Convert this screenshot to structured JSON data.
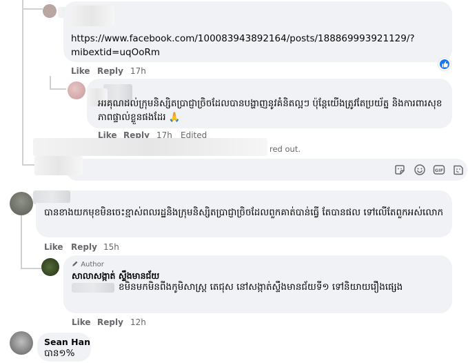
{
  "thread": {
    "link_comment": {
      "text": "https://www.facebook.com/100083943892164/posts/188869993921129/?mibextid=uqOoRm",
      "like": "Like",
      "reply": "Reply",
      "time": "17h",
      "reaction_icon": "like-reaction-icon"
    },
    "thanks_comment": {
      "text": "អរគុណដល់ក្រុមនិស្សិតប្រាជ្ញាច្រិចដែលបានបង្ហាញនូវគំនិតល្អៗ ប៉ុន្តែយើងត្រូវតែប្រយ័ត្ន និងការពារសុខភាពផ្ទាល់ខ្លួនផងដែរ 🙏",
      "like": "Like",
      "reply": "Reply",
      "time": "17h",
      "edited": "Edited"
    },
    "blurred_notice": "red out.",
    "composer_icons": [
      "emoji-sticker-icon",
      "smile-icon",
      "gif-icon",
      "sticker-icon"
    ],
    "comment_three": {
      "text": "បានខាងយកមុខមិនចេះខ្មាស់ពលរដ្ឋនិងក្រុមនិស្សិតប្រាជ្ញាច្រិចដែលពួកគាត់បាន់ធ្វើ តែបានផល ទៅលើតែពួកអស់លោក",
      "like": "Like",
      "reply": "Reply",
      "time": "15h"
    },
    "author_reply": {
      "badge": "Author",
      "badge_icon": "pen-icon",
      "name": "សាលាសង្កាត់ ស្ទឹងមានជ័យ",
      "text": "ខមិនមកមិនពីងកូមិសាស្ត្រ តេជុស នៅសង្កាត់ស្ទឹងមានជ័យទី១ ទៅនិយាយរឿងផ្សេង",
      "like": "Like",
      "reply": "Reply",
      "time": "12h"
    },
    "sean_comment": {
      "name": "Sean Han",
      "text": "បាន១%"
    }
  },
  "colors": {
    "bubble": "#f0f2f5",
    "meta": "#65676b",
    "facebook_blue": "#1877f2",
    "thread_line": "#ced0d4"
  }
}
